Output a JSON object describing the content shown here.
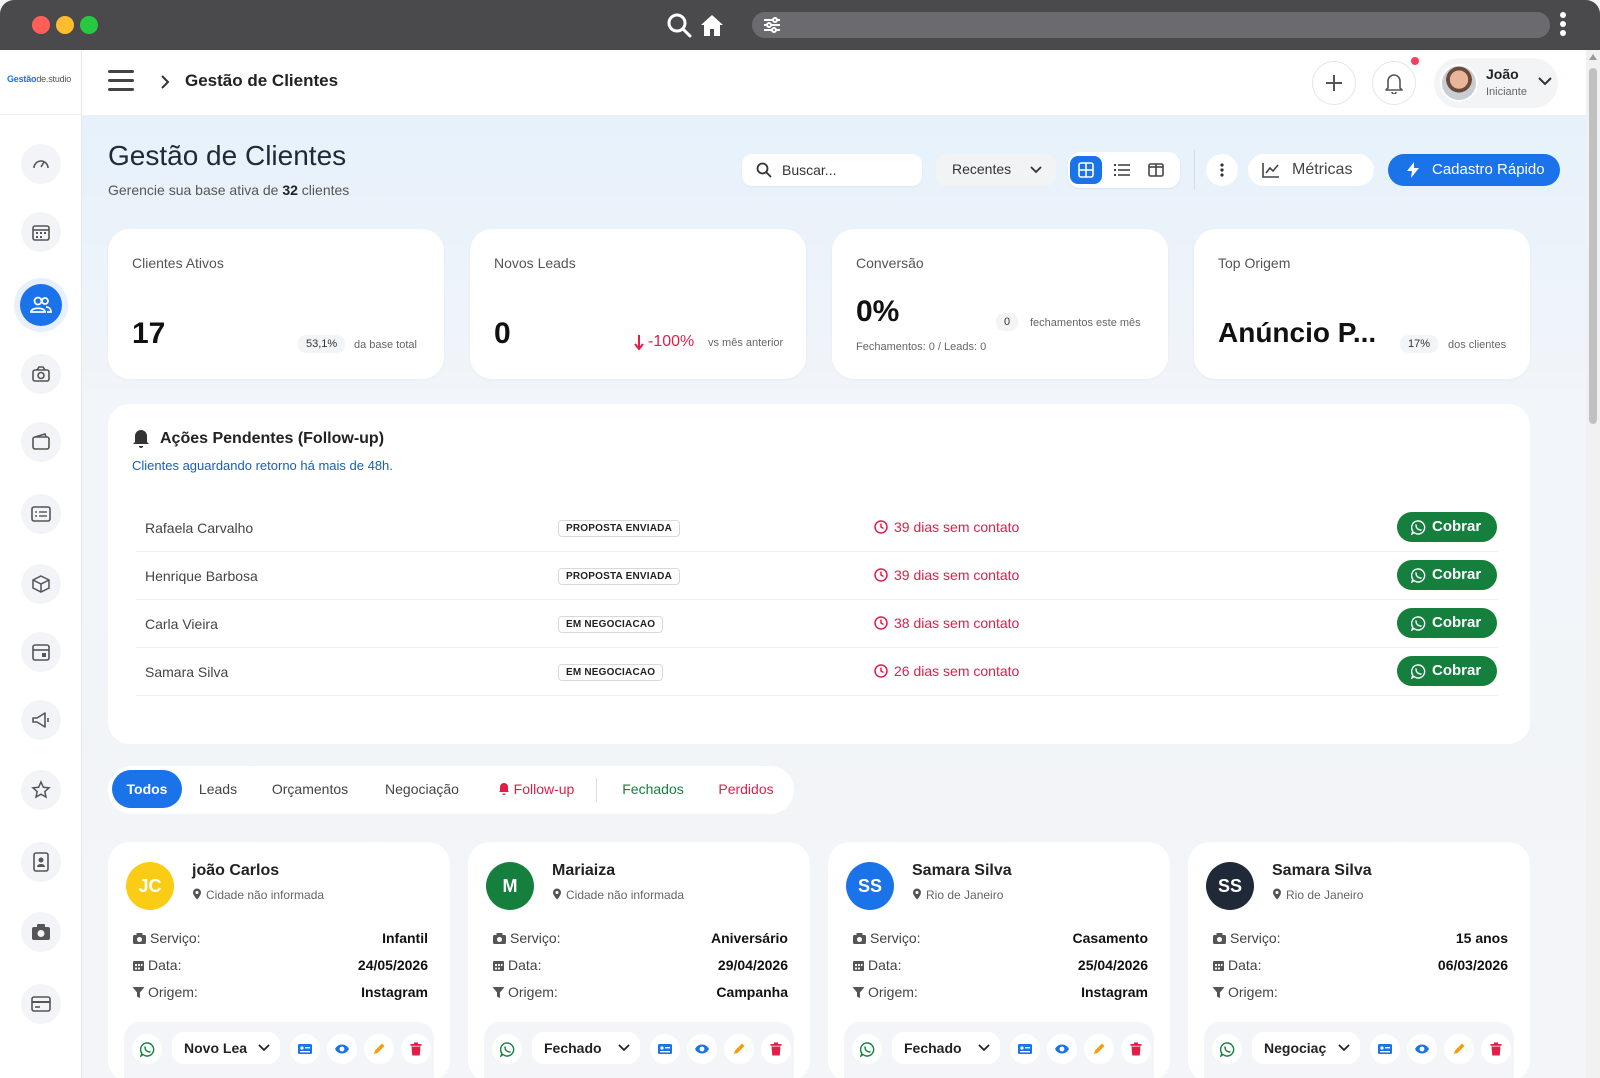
{
  "app": {
    "logo_main": "Gestão",
    "logo_sub": "de.studio"
  },
  "header": {
    "breadcrumb": "Gestão de Clientes",
    "user": {
      "name": "João",
      "role": "Iniciante"
    }
  },
  "page": {
    "title": "Gestão de Clientes",
    "subtitle_prefix": "Gerencie sua base ativa de ",
    "subtitle_count": "32",
    "subtitle_suffix": " clientes"
  },
  "toolbar": {
    "search_placeholder": "Buscar...",
    "sort_value": "Recentes",
    "metrics_label": "Métricas",
    "quick_register_label": "Cadastro Rápido"
  },
  "stats": {
    "active": {
      "label": "Clientes Ativos",
      "value": "17",
      "pill": "53,1%",
      "note": "da base total"
    },
    "leads": {
      "label": "Novos Leads",
      "value": "0",
      "change": "-100%",
      "note": "vs mês anterior"
    },
    "conversion": {
      "label": "Conversão",
      "value": "0%",
      "pill": "0",
      "note": "fechamentos este mês",
      "detail": "Fechamentos: 0 / Leads: 0"
    },
    "top_origin": {
      "label": "Top Origem",
      "value": "Anúncio P...",
      "pill": "17%",
      "note": "dos clientes"
    }
  },
  "followup": {
    "title": "Ações Pendentes (Follow-up)",
    "subtitle": "Clientes aguardando retorno há mais de 48h.",
    "button_label": "Cobrar",
    "rows": [
      {
        "name": "Rafaela Carvalho",
        "status": "PROPOSTA ENVIADA",
        "days": "39 dias sem contato"
      },
      {
        "name": "Henrique Barbosa",
        "status": "PROPOSTA ENVIADA",
        "days": "39 dias sem contato"
      },
      {
        "name": "Carla Vieira",
        "status": "EM NEGOCIACAO",
        "days": "38 dias sem contato"
      },
      {
        "name": "Samara Silva",
        "status": "EM NEGOCIACAO",
        "days": "26 dias sem contato"
      }
    ]
  },
  "tabs": [
    "Todos",
    "Leads",
    "Orçamentos",
    "Negociação",
    "Follow-up",
    "Fechados",
    "Perdidos"
  ],
  "field_labels": {
    "service": "Serviço:",
    "date": "Data:",
    "origin": "Origem:"
  },
  "clients": [
    {
      "initials": "JC",
      "color": "#facc15",
      "name": "joão Carlos",
      "city": "Cidade não informada",
      "service": "Infantil",
      "date": "24/05/2026",
      "origin": "Instagram",
      "stage": "Novo Lea"
    },
    {
      "initials": "M",
      "color": "#15803d",
      "name": "Mariaiza",
      "city": "Cidade não informada",
      "service": "Aniversário",
      "date": "29/04/2026",
      "origin": "Campanha",
      "stage": "Fechado"
    },
    {
      "initials": "SS",
      "color": "#1a73e8",
      "name": "Samara Silva",
      "city": "Rio de Janeiro",
      "service": "Casamento",
      "date": "25/04/2026",
      "origin": "Instagram",
      "stage": "Fechado"
    },
    {
      "initials": "SS",
      "color": "#1f2937",
      "name": "Samara Silva",
      "city": "Rio de Janeiro",
      "service": "15 anos",
      "date": "06/03/2026",
      "origin": "",
      "stage": "Negociaç"
    }
  ],
  "colors": {
    "primary": "#1a73e8",
    "success": "#15803d",
    "danger": "#e11d48"
  }
}
